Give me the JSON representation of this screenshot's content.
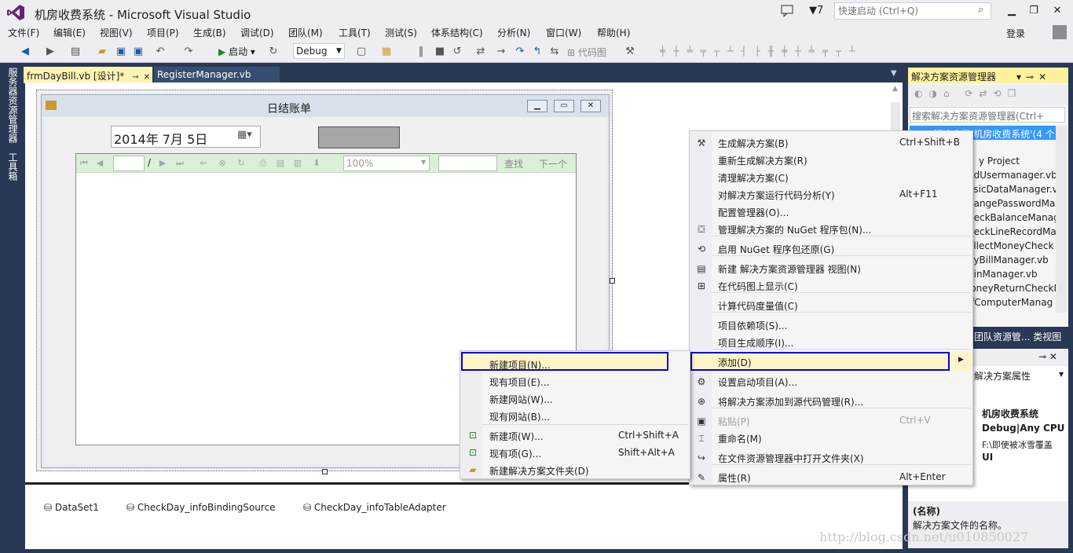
{
  "window": {
    "title": "机房收费系统 - Microsoft Visual Studio",
    "notifications_count": "7",
    "quick_launch_placeholder": "快速启动 (Ctrl+Q)",
    "login": "登录"
  },
  "menubar": [
    "文件(F)",
    "编辑(E)",
    "视图(V)",
    "项目(P)",
    "生成(B)",
    "调试(D)",
    "团队(M)",
    "工具(T)",
    "测试(S)",
    "体系结构(C)",
    "分析(N)",
    "窗口(W)",
    "帮助(H)"
  ],
  "toolbar": {
    "start_label": "启动",
    "config": "Debug",
    "codemap_label": "代码图"
  },
  "left_strip": [
    "服务器资源管理器",
    "工具箱"
  ],
  "doc_tabs": [
    "frmDayBill.vb [设计]*",
    "RegisterManager.vb"
  ],
  "form": {
    "title": "日结账单",
    "date": "2014年  7月  5日",
    "report_zoom": "100%",
    "report_page_sep": "/",
    "find_label": "查找",
    "next_label": "下一个"
  },
  "tray": [
    "DataSet1",
    "CheckDay_infoBindingSource",
    "CheckDay_infoTableAdapter"
  ],
  "solution_explorer": {
    "title": "解决方案资源管理器",
    "search_placeholder": "搜索解决方案资源管理器(Ctrl+",
    "selected_item": "解决方案'机房收费系统'(4 个",
    "items": [
      "y Project",
      "ddUsermanager.vb",
      "asicDataManager.v",
      "hangePasswordMa",
      "heckBalanceManag",
      "heckLineRecordMa",
      "ollectMoneyCheck",
      "ayBillManager.vb",
      "ginManager.vb",
      "loneyReturnCheckN",
      "ffComputerManag"
    ],
    "bottom_tabs": "团队资源管...  类视图"
  },
  "properties": {
    "header": "解决方案属性",
    "rows": [
      "机房收费系统",
      "Debug|Any CPU",
      "F:\\即使被冰雪覆盖",
      "UI"
    ],
    "desc_title": "(名称)",
    "desc_text": "解决方案文件的名称。"
  },
  "context_main": [
    {
      "label": "生成解决方案(B)",
      "shortcut": "Ctrl+Shift+B",
      "icon": "build-icon"
    },
    {
      "label": "重新生成解决方案(R)",
      "shortcut": "",
      "icon": ""
    },
    {
      "label": "清理解决方案(C)",
      "shortcut": "",
      "icon": ""
    },
    {
      "label": "对解决方案运行代码分析(Y)",
      "shortcut": "Alt+F11",
      "icon": ""
    },
    {
      "label": "配置管理器(O)...",
      "shortcut": "",
      "icon": ""
    },
    {
      "label": "管理解决方案的 NuGet 程序包(N)...",
      "shortcut": "",
      "icon": "nuget-icon"
    },
    {
      "label": "启用 NuGet 程序包还原(G)",
      "shortcut": "",
      "icon": "restore-icon"
    },
    {
      "label": "新建 解决方案资源管理器 视图(N)",
      "shortcut": "",
      "icon": "new-view-icon"
    },
    {
      "label": "在代码图上显示(C)",
      "shortcut": "",
      "icon": "codemap-icon"
    },
    {
      "label": "计算代码度量值(C)",
      "shortcut": "",
      "icon": ""
    },
    {
      "label": "项目依赖项(S)...",
      "shortcut": "",
      "icon": ""
    },
    {
      "label": "项目生成顺序(I)...",
      "shortcut": "",
      "icon": ""
    },
    {
      "label": "添加(D)",
      "shortcut": "",
      "icon": ""
    },
    {
      "label": "设置启动项目(A)...",
      "shortcut": "",
      "icon": "gear-icon"
    },
    {
      "label": "将解决方案添加到源代码管理(R)...",
      "shortcut": "",
      "icon": "source-control-icon"
    },
    {
      "label": "粘贴(P)",
      "shortcut": "Ctrl+V",
      "icon": "paste-icon"
    },
    {
      "label": "重命名(M)",
      "shortcut": "",
      "icon": "rename-icon"
    },
    {
      "label": "在文件资源管理器中打开文件夹(X)",
      "shortcut": "",
      "icon": "open-folder-icon"
    },
    {
      "label": "属性(R)",
      "shortcut": "Alt+Enter",
      "icon": "wrench-icon"
    }
  ],
  "context_sub": [
    {
      "label": "新建项目(N)...",
      "shortcut": ""
    },
    {
      "label": "现有项目(E)...",
      "shortcut": ""
    },
    {
      "label": "新建网站(W)...",
      "shortcut": ""
    },
    {
      "label": "现有网站(B)...",
      "shortcut": ""
    },
    {
      "label": "新建项(W)...",
      "shortcut": "Ctrl+Shift+A"
    },
    {
      "label": "现有项(G)...",
      "shortcut": "Shift+Alt+A"
    },
    {
      "label": "新建解决方案文件夹(D)",
      "shortcut": ""
    }
  ],
  "watermark": "http://blog.csdn.net/u010850027"
}
